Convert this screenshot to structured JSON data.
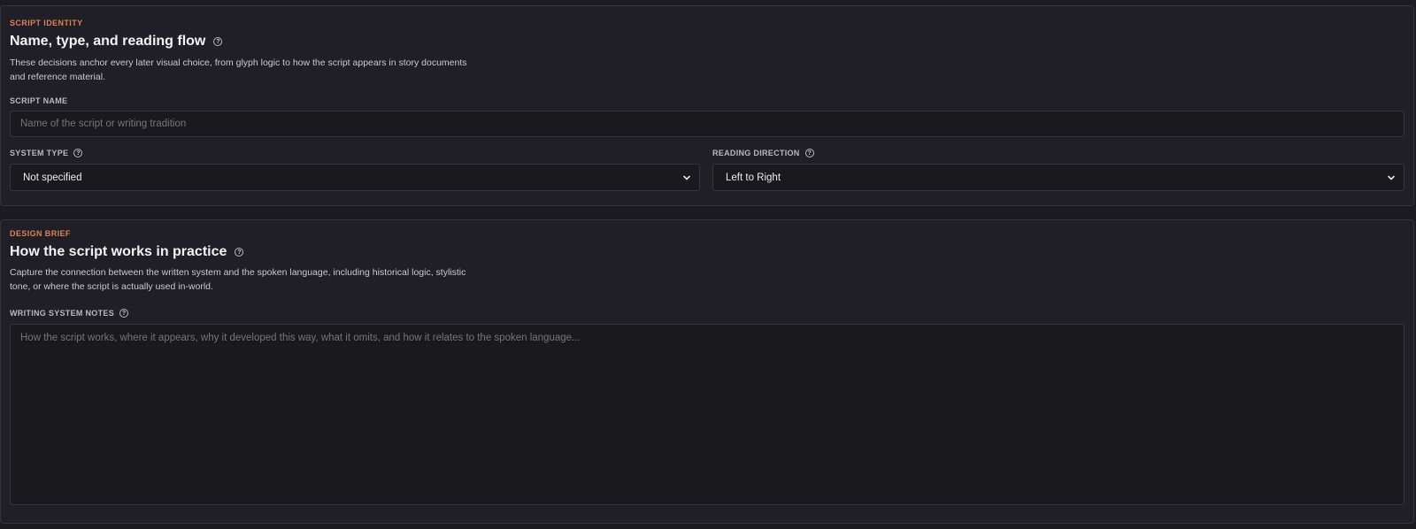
{
  "identity": {
    "eyebrow": "SCRIPT IDENTITY",
    "title": "Name, type, and reading flow",
    "description_line1": "These decisions anchor every later visual choice, from glyph logic to how the script appears in story documents",
    "description_line2": "and reference material.",
    "script_name": {
      "label": "SCRIPT NAME",
      "placeholder": "Name of the script or writing tradition",
      "value": ""
    },
    "system_type": {
      "label": "SYSTEM TYPE",
      "selected": "Not specified"
    },
    "reading_direction": {
      "label": "READING DIRECTION",
      "selected": "Left to Right"
    }
  },
  "brief": {
    "eyebrow": "DESIGN BRIEF",
    "title": "How the script works in practice",
    "description_line1": "Capture the connection between the written system and the spoken language, including historical logic, stylistic",
    "description_line2": "tone, or where the script is actually used in-world.",
    "notes": {
      "label": "WRITING SYSTEM NOTES",
      "placeholder": "How the script works, where it appears, why it developed this way, what it omits, and how it relates to the spoken language...",
      "value": ""
    }
  },
  "icons": {
    "help": "help-circle-icon",
    "dropdown": "chevron-down-icon"
  },
  "colors": {
    "accent": "#d9825a",
    "background": "#1b1b20",
    "card": "#1f1f25",
    "field": "#19191e",
    "border": "#34343b"
  }
}
